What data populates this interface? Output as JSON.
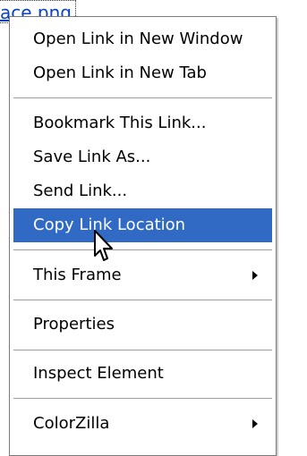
{
  "link": {
    "text": "ace.png"
  },
  "menu": {
    "items": [
      {
        "label": "Open Link in New Window"
      },
      {
        "label": "Open Link in New Tab"
      },
      {
        "label": "Bookmark This Link..."
      },
      {
        "label": "Save Link As..."
      },
      {
        "label": "Send Link..."
      },
      {
        "label": "Copy Link Location",
        "state": "highlighted"
      },
      {
        "label": "This Frame",
        "submenu": true
      },
      {
        "label": "Properties"
      },
      {
        "label": "Inspect Element"
      },
      {
        "label": "ColorZilla",
        "submenu": true
      }
    ]
  },
  "colors": {
    "highlight": "#316ac5",
    "link": "#0b43b9",
    "separator": "#9d9d9d"
  },
  "icons": {
    "submenu": "triangle-right-icon",
    "cursor": "arrow-pointer-icon"
  }
}
